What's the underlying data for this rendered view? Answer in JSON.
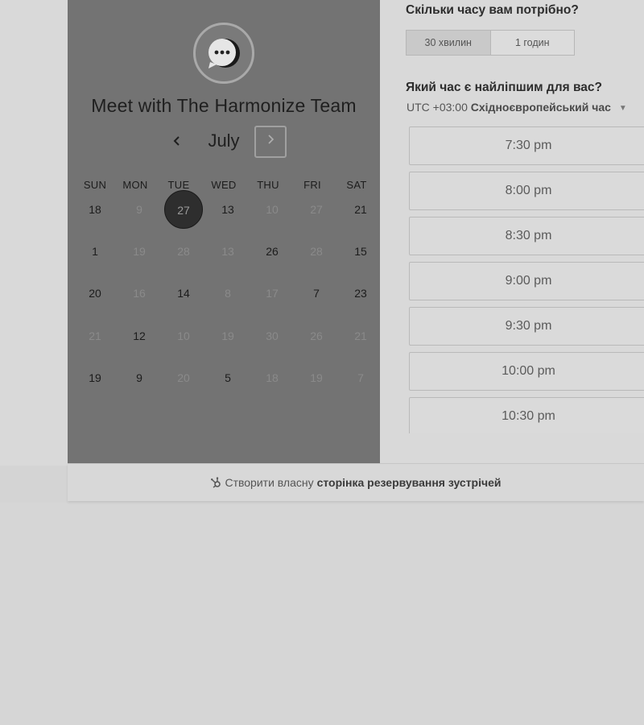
{
  "booking": {
    "title": "Meet with The Harmonize Team",
    "calendar": {
      "month": "July",
      "prev_icon": "chevron-left-icon",
      "next_icon": "chevron-right-icon",
      "weekdays": [
        "SUN",
        "MON",
        "TUE",
        "WED",
        "THU",
        "FRI",
        "SAT"
      ],
      "weeks": [
        [
          "18",
          "9",
          "27",
          "13",
          "10",
          "27",
          "21"
        ],
        [
          "1",
          "19",
          "28",
          "13",
          "26",
          "28",
          "15"
        ],
        [
          "20",
          "16",
          "14",
          "8",
          "17",
          "7",
          "23"
        ],
        [
          "21",
          "12",
          "10",
          "19",
          "30",
          "26",
          "21"
        ],
        [
          "19",
          "9",
          "20",
          "5",
          "18",
          "19",
          "7"
        ]
      ],
      "selected_day": "27"
    },
    "duration": {
      "question": "Скільки часу вам потрібно?",
      "options": [
        "30 хвилин",
        "1 годин"
      ],
      "selected": "30 хвилин"
    },
    "time": {
      "question": "Який час є найліпшим для вас?",
      "timezone_prefix": "UTC +03:00",
      "timezone_name": "Східноєвропейський час",
      "slots": [
        "7:30 pm",
        "8:00 pm",
        "8:30 pm",
        "9:00 pm",
        "9:30 pm",
        "10:00 pm",
        "10:30 pm"
      ]
    }
  },
  "footer": {
    "text_prefix": "Створити власну",
    "text_link": "сторінка резервування зустрічей",
    "icon": "hubspot-sprocket-icon"
  }
}
